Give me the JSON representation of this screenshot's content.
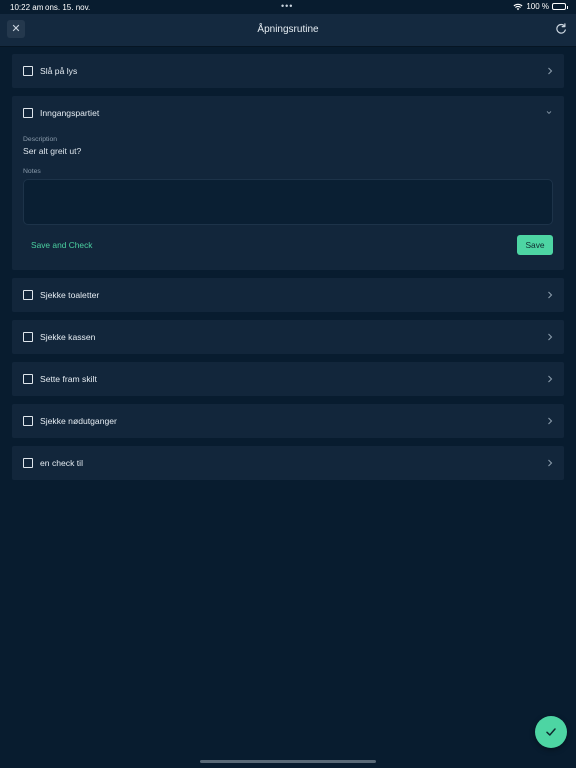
{
  "status_bar": {
    "time": "10:22 am",
    "date": "ons. 15. nov.",
    "center": "•••",
    "battery": "100 %"
  },
  "header": {
    "title": "Åpningsrutine",
    "close_icon": "close-icon",
    "refresh_icon": "refresh-icon"
  },
  "items": [
    {
      "label": "Slå på lys",
      "checked": false
    },
    {
      "label": "Inngangspartiet",
      "checked": false,
      "expanded": true
    },
    {
      "label": "Sjekke toaletter",
      "checked": false
    },
    {
      "label": "Sjekke kassen",
      "checked": false
    },
    {
      "label": "Sette fram skilt",
      "checked": false
    },
    {
      "label": "Sjekke nødutganger",
      "checked": false
    },
    {
      "label": "en check til",
      "checked": false
    }
  ],
  "detail": {
    "description_label": "Description",
    "description_text": "Ser alt greit ut?",
    "notes_label": "Notes",
    "notes_value": "",
    "save_and_check_label": "Save and Check",
    "save_label": "Save"
  },
  "colors": {
    "background": "#081c2f",
    "card": "#12263b",
    "accent": "#4dd5a3"
  }
}
